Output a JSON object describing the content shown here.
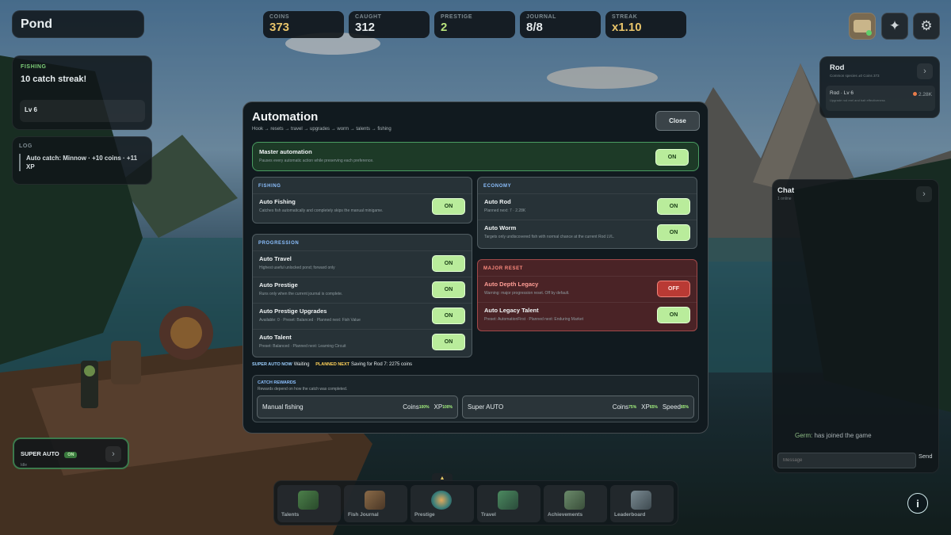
{
  "hud": {
    "location": "Pond",
    "stats": [
      {
        "label": "COINS",
        "value": "373"
      },
      {
        "label": "CAUGHT",
        "value": "312"
      },
      {
        "label": "PRESTIGE",
        "value": "2"
      },
      {
        "label": "JOURNAL",
        "value": "8/8"
      },
      {
        "label": "STREAK",
        "value": "x1.10"
      }
    ]
  },
  "fishing_panel": {
    "label": "FISHING",
    "message": "10 catch streak!",
    "level": "Lv 6"
  },
  "log_panel": {
    "label": "LOG",
    "entry": "Auto catch: Minnow · +10 coins · +11 XP"
  },
  "super_auto_widget": {
    "title": "SUPER AUTO",
    "state": "ON",
    "sub": "Idle"
  },
  "rod_panel": {
    "title": "Rod",
    "sub": "Common species ±0 Coins 373",
    "item": "Rod · Lv 6",
    "item_sub": "Upgrade rod reel and bait effectiveness",
    "cost": "2.28K"
  },
  "chat": {
    "title": "Chat",
    "sub": "1 online",
    "message_user": "Germ:",
    "message_text": "has joined the game",
    "placeholder": "Message",
    "send": "Send"
  },
  "modal": {
    "title": "Automation",
    "subtitle": "Hook → resets → travel → upgrades → worm → talents → fishing",
    "close": "Close",
    "master": {
      "title": "Master automation",
      "desc": "Pauses every automatic action while preserving each preference.",
      "state": "ON"
    },
    "fishing": {
      "header": "FISHING",
      "items": [
        {
          "title": "Auto Fishing",
          "desc": "Catches fish automatically and completely skips the manual minigame.",
          "state": "ON"
        }
      ]
    },
    "progression": {
      "header": "PROGRESSION",
      "items": [
        {
          "title": "Auto Travel",
          "desc": "Highest useful unlocked pond; forward only",
          "state": "ON"
        },
        {
          "title": "Auto Prestige",
          "desc": "Runs only when the current journal is complete.",
          "state": "ON"
        },
        {
          "title": "Auto Prestige Upgrades",
          "desc": "Available: 0 · Preset: Balanced · Planned next: Fish Value",
          "state": "ON"
        },
        {
          "title": "Auto Talent",
          "desc": "Preset: Balanced · Planned next: Learning Circuit",
          "state": "ON"
        }
      ]
    },
    "economy": {
      "header": "ECONOMY",
      "items": [
        {
          "title": "Auto Rod",
          "desc": "Planned next: 7 · 2.28K",
          "state": "ON"
        },
        {
          "title": "Auto Worm",
          "desc": "Targets only undiscovered fish with normal chance at the current Rod LVL.",
          "state": "ON"
        }
      ]
    },
    "major_reset": {
      "header": "MAJOR RESET",
      "items": [
        {
          "title": "Auto Depth Legacy",
          "desc": "Warning: major progression reset. Off by default.",
          "state": "OFF"
        },
        {
          "title": "Auto Legacy Talent",
          "desc": "Preset: AutomationFirst · Planned next: Enduring Market",
          "state": "ON"
        }
      ]
    },
    "status": {
      "badge1": "SUPER AUTO NOW",
      "text1": "Waiting",
      "badge2": "PLANNED NEXT",
      "text2": "Saving for Rod 7: 2275 coins"
    },
    "rewards": {
      "header": "CATCH REWARDS",
      "desc": "Rewards depend on how the catch was completed.",
      "manual": {
        "label": "Manual fishing",
        "coins_label": "Coins",
        "coins": "100%",
        "xp_label": "XP",
        "xp": "100%"
      },
      "super": {
        "label": "Super AUTO",
        "coins_label": "Coins",
        "coins": "75%",
        "xp_label": "XP",
        "xp": "65%",
        "speed_label": "Speed",
        "speed": "85%"
      }
    }
  },
  "nav": [
    "Talents",
    "Fish Journal",
    "Prestige",
    "Travel",
    "Achievements",
    "Leaderboard"
  ],
  "colors": {
    "accent_on": "#b9ec9b",
    "accent_off": "#b93a34",
    "coin_gold": "#e8c46a"
  }
}
